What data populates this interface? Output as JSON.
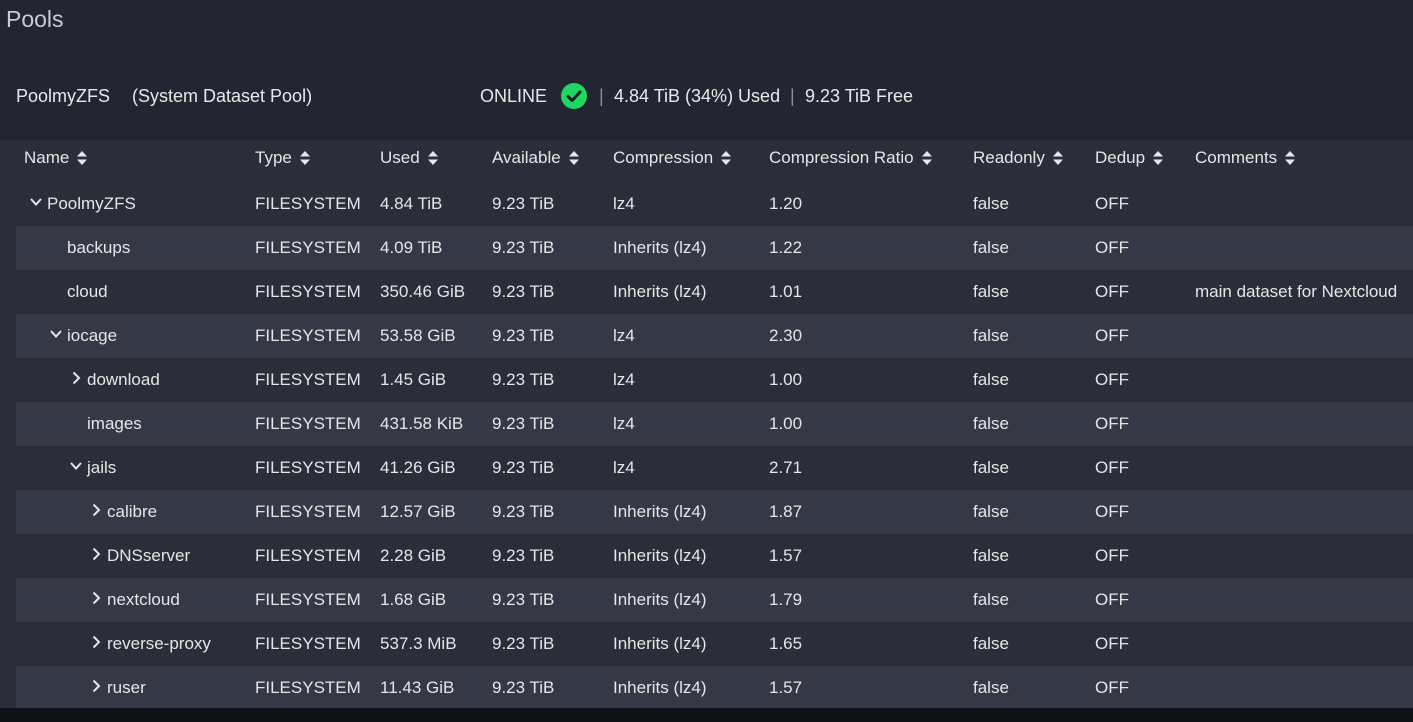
{
  "page": {
    "title": "Pools"
  },
  "pool": {
    "name": "PoolmyZFS",
    "subtitle": "(System Dataset Pool)",
    "status": "ONLINE",
    "status_icon": "check-circle-icon",
    "status_color": "#1ed760",
    "used": "4.84 TiB (34%) Used",
    "free": "9.23 TiB Free",
    "separator": "|"
  },
  "table": {
    "columns": [
      "Name",
      "Type",
      "Used",
      "Available",
      "Compression",
      "Compression Ratio",
      "Readonly",
      "Dedup",
      "Comments"
    ],
    "rows": [
      {
        "name": "PoolmyZFS",
        "expander": "expanded",
        "type": "FILESYSTEM",
        "used": "4.84 TiB",
        "available": "9.23 TiB",
        "compression": "lz4",
        "ratio": "1.20",
        "readonly": "false",
        "dedup": "OFF",
        "comments": ""
      },
      {
        "name": "backups",
        "expander": "none",
        "type": "FILESYSTEM",
        "used": "4.09 TiB",
        "available": "9.23 TiB",
        "compression": "Inherits (lz4)",
        "ratio": "1.22",
        "readonly": "false",
        "dedup": "OFF",
        "comments": ""
      },
      {
        "name": "cloud",
        "expander": "none",
        "type": "FILESYSTEM",
        "used": "350.46 GiB",
        "available": "9.23 TiB",
        "compression": "Inherits (lz4)",
        "ratio": "1.01",
        "readonly": "false",
        "dedup": "OFF",
        "comments": "main dataset for Nextcloud"
      },
      {
        "name": "iocage",
        "expander": "expanded",
        "type": "FILESYSTEM",
        "used": "53.58 GiB",
        "available": "9.23 TiB",
        "compression": "lz4",
        "ratio": "2.30",
        "readonly": "false",
        "dedup": "OFF",
        "comments": ""
      },
      {
        "name": "download",
        "expander": "collapsed",
        "type": "FILESYSTEM",
        "used": "1.45 GiB",
        "available": "9.23 TiB",
        "compression": "lz4",
        "ratio": "1.00",
        "readonly": "false",
        "dedup": "OFF",
        "comments": ""
      },
      {
        "name": "images",
        "expander": "none",
        "type": "FILESYSTEM",
        "used": "431.58 KiB",
        "available": "9.23 TiB",
        "compression": "lz4",
        "ratio": "1.00",
        "readonly": "false",
        "dedup": "OFF",
        "comments": ""
      },
      {
        "name": "jails",
        "expander": "expanded",
        "type": "FILESYSTEM",
        "used": "41.26 GiB",
        "available": "9.23 TiB",
        "compression": "lz4",
        "ratio": "2.71",
        "readonly": "false",
        "dedup": "OFF",
        "comments": ""
      },
      {
        "name": "calibre",
        "expander": "collapsed",
        "type": "FILESYSTEM",
        "used": "12.57 GiB",
        "available": "9.23 TiB",
        "compression": "Inherits (lz4)",
        "ratio": "1.87",
        "readonly": "false",
        "dedup": "OFF",
        "comments": ""
      },
      {
        "name": "DNSserver",
        "expander": "collapsed",
        "type": "FILESYSTEM",
        "used": "2.28 GiB",
        "available": "9.23 TiB",
        "compression": "Inherits (lz4)",
        "ratio": "1.57",
        "readonly": "false",
        "dedup": "OFF",
        "comments": ""
      },
      {
        "name": "nextcloud",
        "expander": "collapsed",
        "type": "FILESYSTEM",
        "used": "1.68 GiB",
        "available": "9.23 TiB",
        "compression": "Inherits (lz4)",
        "ratio": "1.79",
        "readonly": "false",
        "dedup": "OFF",
        "comments": ""
      },
      {
        "name": "reverse-proxy",
        "expander": "collapsed",
        "type": "FILESYSTEM",
        "used": "537.3 MiB",
        "available": "9.23 TiB",
        "compression": "Inherits (lz4)",
        "ratio": "1.65",
        "readonly": "false",
        "dedup": "OFF",
        "comments": ""
      },
      {
        "name": "ruser",
        "expander": "collapsed",
        "type": "FILESYSTEM",
        "used": "11.43 GiB",
        "available": "9.23 TiB",
        "compression": "Inherits (lz4)",
        "ratio": "1.57",
        "readonly": "false",
        "dedup": "OFF",
        "comments": ""
      }
    ]
  }
}
